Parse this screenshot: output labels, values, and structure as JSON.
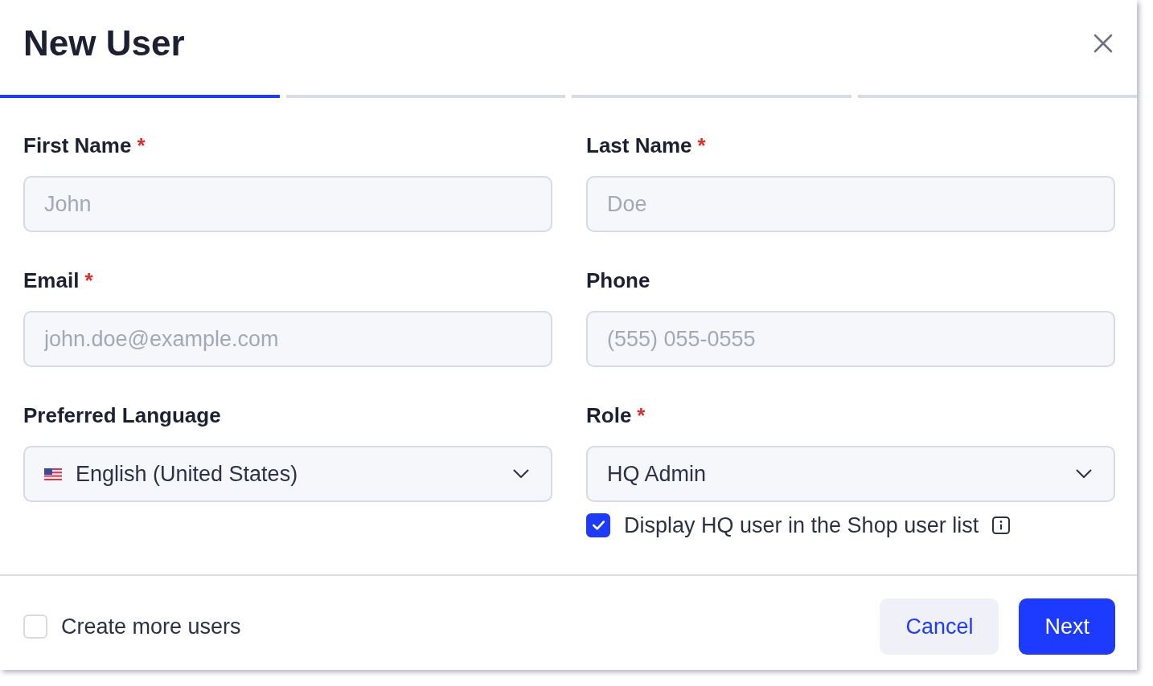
{
  "dialog": {
    "title": "New User"
  },
  "steps": [
    {
      "selected": true
    },
    {
      "selected": false
    },
    {
      "selected": false
    },
    {
      "selected": false
    }
  ],
  "fields": [
    {
      "kind": "text",
      "label": "First Name",
      "required_mark": "*",
      "placeholder": "John"
    },
    {
      "kind": "text",
      "label": "Last Name",
      "required_mark": "*",
      "placeholder": "Doe"
    },
    {
      "kind": "text",
      "label": "Email",
      "required_mark": "*",
      "placeholder": "john.doe@example.com"
    },
    {
      "kind": "text",
      "label": "Phone",
      "placeholder": "(555) 055-0555"
    },
    {
      "kind": "language",
      "label": "Preferred Language",
      "value": "English (United States)"
    },
    {
      "kind": "select",
      "label": "Role",
      "required_mark": "*",
      "value": "HQ Admin",
      "option": {
        "label": "Display HQ user in the Shop user list",
        "checked": true
      }
    }
  ],
  "footer": {
    "create_more": {
      "label": "Create more users",
      "checked": false
    },
    "buttons": [
      {
        "kind": "secondary",
        "label": "Cancel"
      },
      {
        "kind": "primary",
        "label": "Next"
      }
    ]
  }
}
